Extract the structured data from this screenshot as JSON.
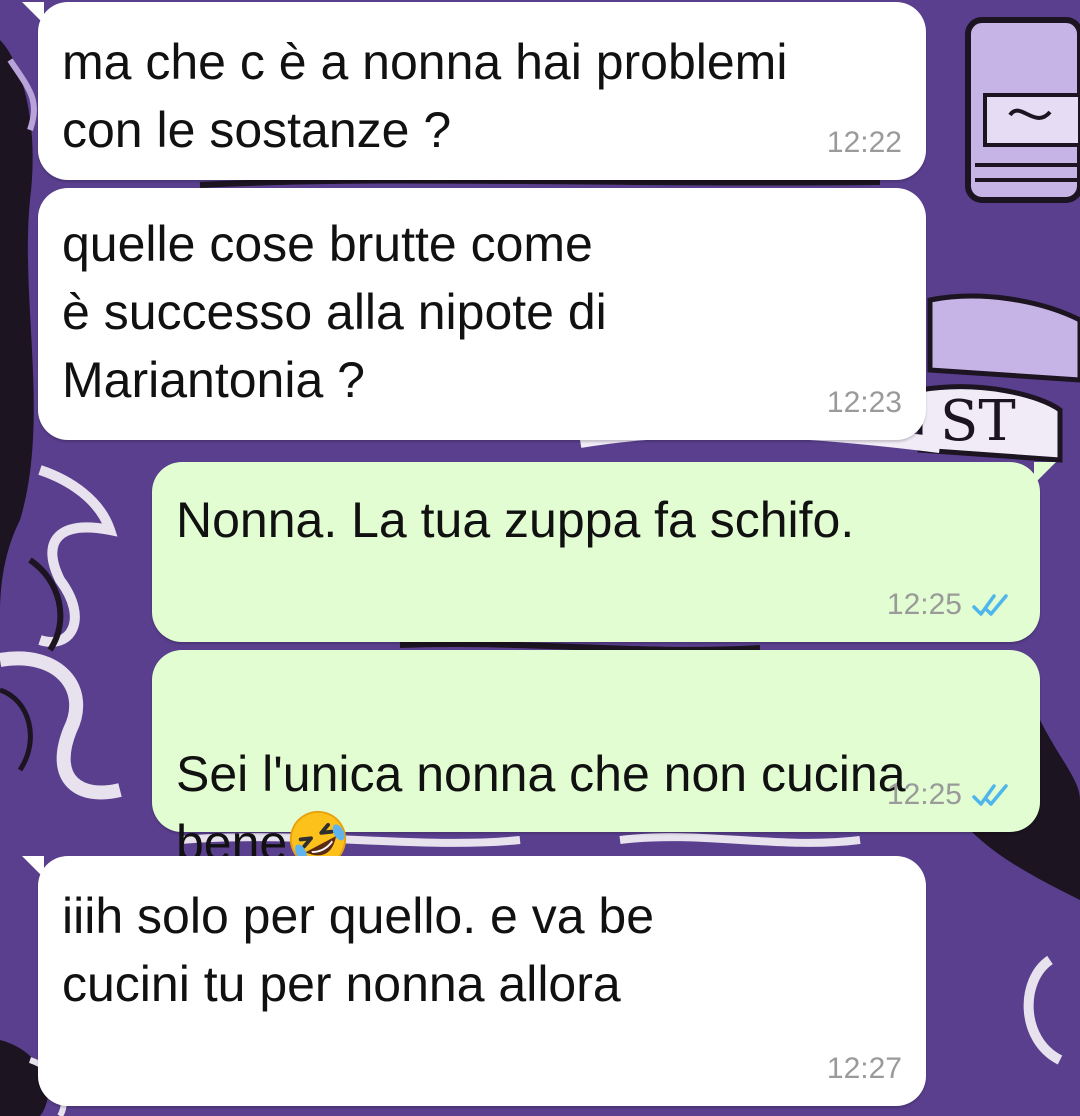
{
  "messages": [
    {
      "id": "m1",
      "direction": "incoming",
      "text": "ma che c è a nonna hai problemi\ncon le sostanze ?",
      "time": "12:22",
      "status": ""
    },
    {
      "id": "m2",
      "direction": "incoming",
      "text": "quelle cose brutte come\nè successo alla nipote di\nMariantonia ?",
      "time": "12:23",
      "status": ""
    },
    {
      "id": "m3",
      "direction": "outgoing",
      "text": "Nonna. La tua zuppa fa schifo.",
      "time": "12:25",
      "status": "read"
    },
    {
      "id": "m4",
      "direction": "outgoing",
      "text": "Sei l'unica nonna che non cucina\nbene",
      "time": "12:25",
      "status": "read",
      "emoji": "rolling-on-the-floor-laughing-emoji"
    },
    {
      "id": "m5",
      "direction": "incoming",
      "text": "iiih solo per quello. e va be\ncucini tu per nonna allora",
      "time": "12:27",
      "status": ""
    }
  ],
  "colors": {
    "wallpaper": "#5a3f8e",
    "incoming_bubble": "#ffffff",
    "outgoing_bubble": "#e1fdd1",
    "read_ticks": "#4fb6ec",
    "timestamp": "#9a9a9a"
  }
}
